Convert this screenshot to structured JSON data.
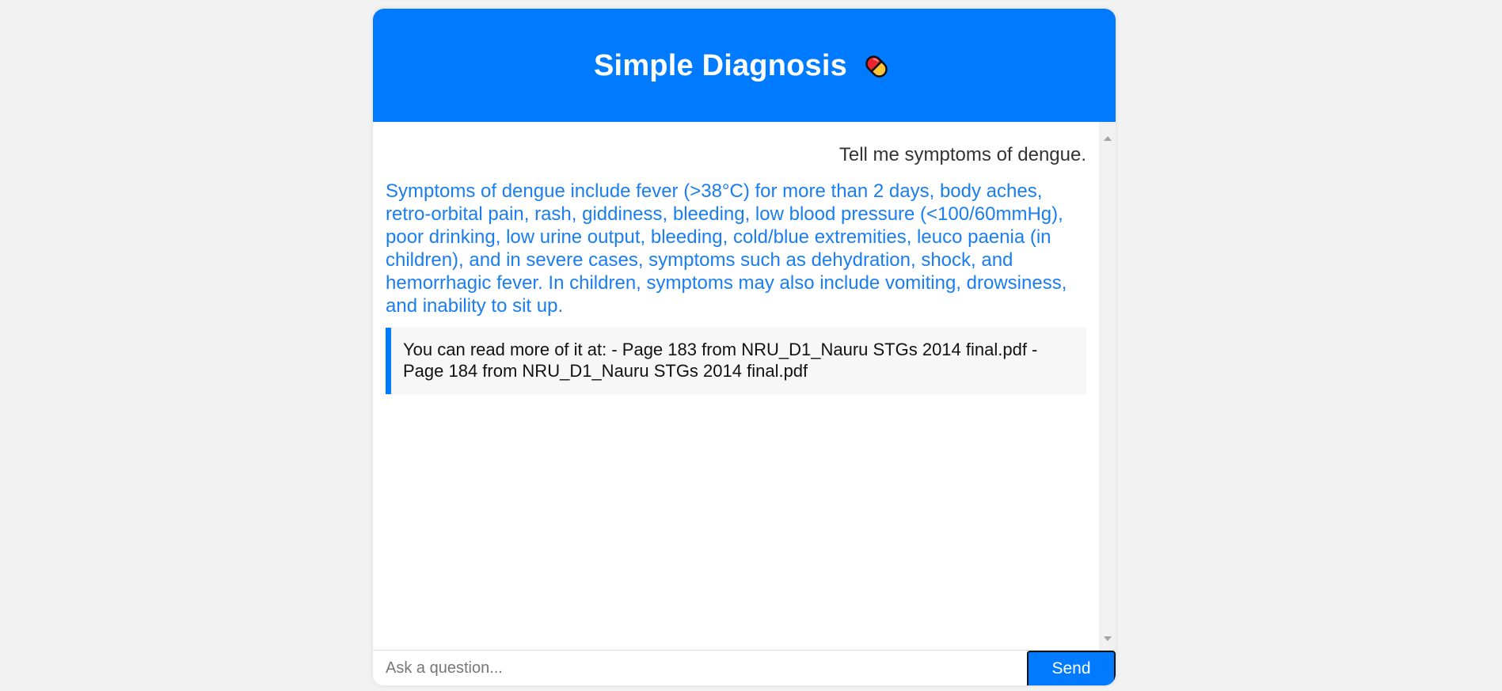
{
  "header": {
    "title": "Simple Diagnosis",
    "icon": "pill-icon"
  },
  "chat": {
    "user_message": "Tell me symptoms of dengue.",
    "bot_message": "Symptoms of dengue include fever (>38°C) for more than 2 days, body aches, retro-orbital pain, rash, giddiness, bleeding, low blood pressure (<100/60mmHg), poor drinking, low urine output, bleeding, cold/blue extremities, leuco paenia (in children), and in severe cases, symptoms such as dehydration, shock, and hemorrhagic fever. In children, symptoms may also include vomiting, drowsiness, and inability to sit up.",
    "source_note": "You can read more of it at: - Page 183 from NRU_D1_Nauru STGs 2014 final.pdf - Page 184 from NRU_D1_Nauru STGs 2014 final.pdf"
  },
  "input": {
    "placeholder": "Ask a question...",
    "value": ""
  },
  "send_button": {
    "label": "Send"
  },
  "colors": {
    "accent": "#007bff",
    "bot_text": "#1a7ef0",
    "background": "#f2f2f2"
  }
}
